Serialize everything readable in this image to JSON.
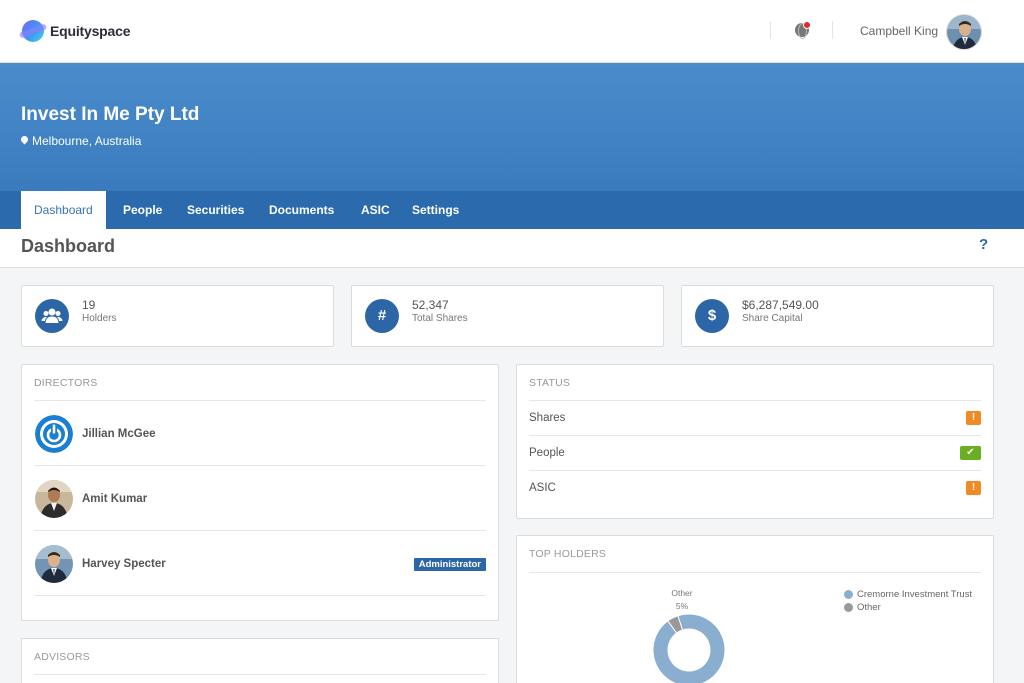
{
  "brand": {
    "name": "Equityspace"
  },
  "user": {
    "name": "Campbell King"
  },
  "company": {
    "name": "Invest In Me Pty Ltd",
    "location": "Melbourne, Australia"
  },
  "tabs": [
    {
      "label": "Dashboard",
      "active": true
    },
    {
      "label": "People"
    },
    {
      "label": "Securities"
    },
    {
      "label": "Documents"
    },
    {
      "label": "ASIC"
    },
    {
      "label": "Settings"
    }
  ],
  "page": {
    "title": "Dashboard",
    "help": "?"
  },
  "stats": [
    {
      "icon": "users-icon",
      "value": "19",
      "label": "Holders"
    },
    {
      "icon": "hash-icon",
      "glyph": "#",
      "value": "52,347",
      "label": "Total Shares"
    },
    {
      "icon": "dollar-icon",
      "glyph": "$",
      "value": "$6,287,549.00",
      "label": "Share Capital"
    }
  ],
  "directors": {
    "title": "DIRECTORS",
    "items": [
      {
        "name": "Jillian McGee",
        "avatar": "power-logo-avatar"
      },
      {
        "name": "Amit Kumar",
        "avatar": "photo-avatar"
      },
      {
        "name": "Harvey Specter",
        "avatar": "photo-avatar",
        "badge": "Administrator"
      }
    ]
  },
  "status": {
    "title": "STATUS",
    "items": [
      {
        "label": "Shares",
        "state": "warning",
        "glyph": "!"
      },
      {
        "label": "People",
        "state": "ok",
        "glyph": "✔"
      },
      {
        "label": "ASIC",
        "state": "warning",
        "glyph": "!"
      }
    ]
  },
  "advisors": {
    "title": "ADVISORS"
  },
  "top_holders": {
    "title": "TOP HOLDERS",
    "other_label": "Other",
    "other_pct": "5%",
    "legend": [
      {
        "name": "Cremorne Investment Trust",
        "color": "#8aaed0"
      },
      {
        "name": "Other",
        "color": "#999999"
      }
    ]
  },
  "chart_data": {
    "type": "pie",
    "title": "TOP HOLDERS",
    "series": [
      {
        "name": "Cremorne Investment Trust",
        "value": 95,
        "color": "#8aaed0"
      },
      {
        "name": "Other",
        "value": 5,
        "color": "#999999"
      }
    ]
  },
  "colors": {
    "primary": "#2d66a6",
    "hero": "#4a8ccc",
    "warning": "#f08a24",
    "ok": "#6aae21"
  }
}
